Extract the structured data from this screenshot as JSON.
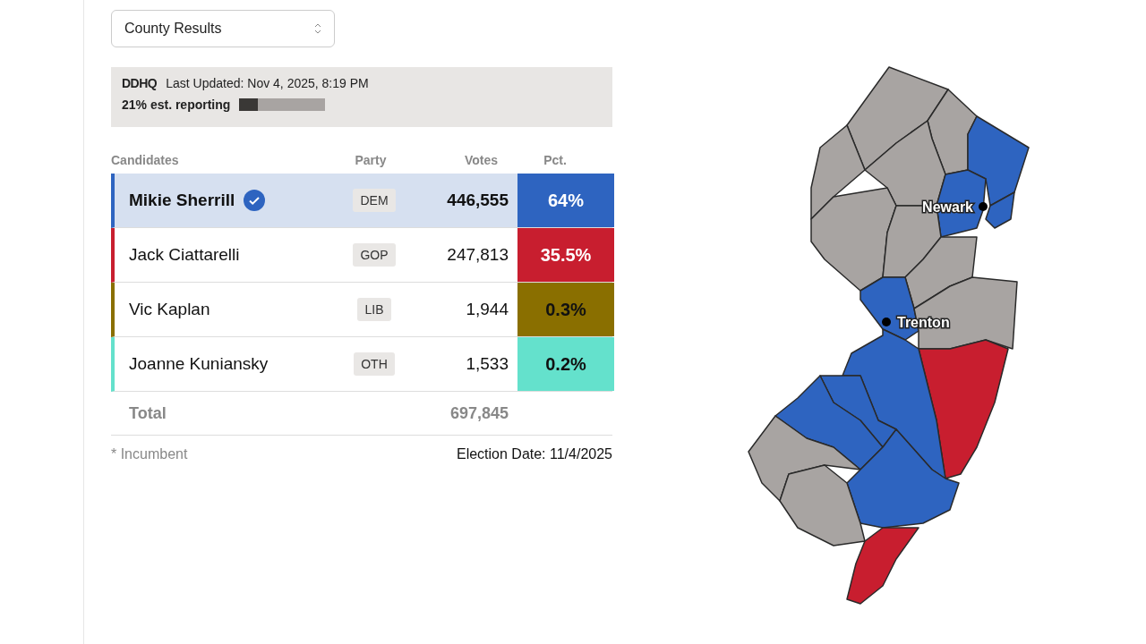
{
  "dropdown": {
    "value": "County Results"
  },
  "status": {
    "logo": "DDHQ",
    "updated": "Last Updated: Nov 4, 2025, 8:19 PM",
    "reporting": "21% est. reporting",
    "level": 0.21
  },
  "table": {
    "columns": [
      "Candidates",
      "Party",
      "Votes",
      "Pct."
    ],
    "rows": [
      {
        "name": "Mikie Sherrill",
        "party": "DEM",
        "votes": "446,555",
        "pct": "64%",
        "color": "#2e64c0",
        "winner": true
      },
      {
        "name": "Jack Ciattarelli",
        "party": "GOP",
        "votes": "247,813",
        "pct": "35.5%",
        "color": "#c81e2f",
        "winner": false
      },
      {
        "name": "Vic Kaplan",
        "party": "LIB",
        "votes": "1,944",
        "pct": "0.3%",
        "color": "#8a6f00",
        "winner": false
      },
      {
        "name": "Joanne Kuniansky",
        "party": "OTH",
        "votes": "1,533",
        "pct": "0.2%",
        "color": "#64e1cc",
        "winner": false
      }
    ],
    "total": {
      "label": "Total",
      "votes": "697,845"
    }
  },
  "footer": {
    "note": "* Incumbent",
    "date": "Election Date: 11/4/2025"
  },
  "map": {
    "cities": [
      {
        "label": "Newark"
      },
      {
        "label": "Trenton"
      }
    ]
  }
}
